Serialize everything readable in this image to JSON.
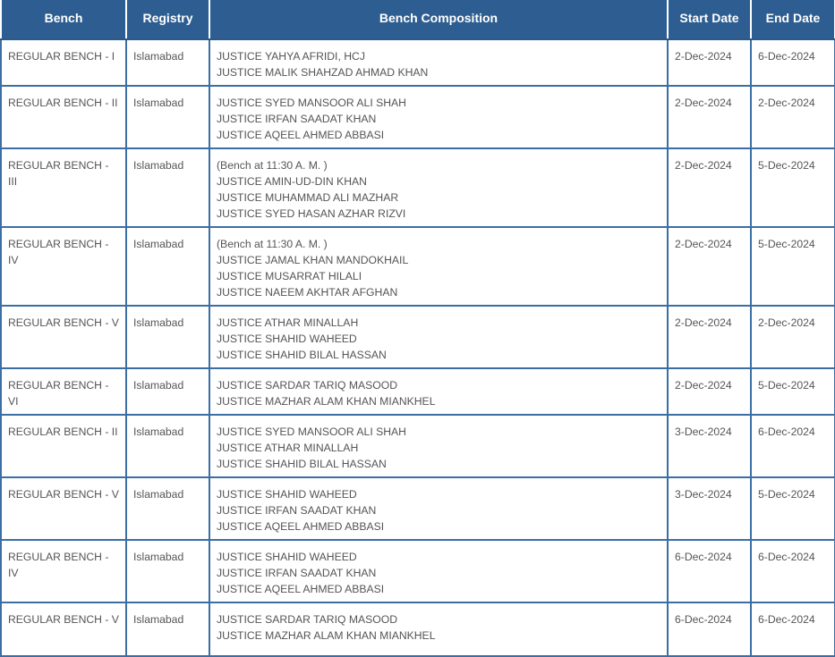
{
  "headers": {
    "bench": "Bench",
    "registry": "Registry",
    "composition": "Bench Composition",
    "start": "Start Date",
    "end": "End Date"
  },
  "rows": [
    {
      "bench": "REGULAR BENCH - I",
      "registry": "Islamabad",
      "composition": [
        "JUSTICE YAHYA AFRIDI, HCJ",
        "JUSTICE MALIK SHAHZAD AHMAD KHAN"
      ],
      "start": "2-Dec-2024",
      "end": "6-Dec-2024"
    },
    {
      "bench": "REGULAR BENCH - II",
      "registry": "Islamabad",
      "composition": [
        "JUSTICE SYED MANSOOR ALI SHAH",
        "JUSTICE IRFAN SAADAT KHAN",
        "JUSTICE AQEEL AHMED ABBASI"
      ],
      "start": "2-Dec-2024",
      "end": "2-Dec-2024"
    },
    {
      "bench": "REGULAR BENCH - III",
      "registry": "Islamabad",
      "composition": [
        "(Bench at 11:30 A. M. )",
        "JUSTICE AMIN-UD-DIN KHAN",
        "JUSTICE MUHAMMAD ALI MAZHAR",
        "JUSTICE SYED HASAN AZHAR RIZVI"
      ],
      "start": "2-Dec-2024",
      "end": "5-Dec-2024"
    },
    {
      "bench": "REGULAR BENCH - IV",
      "registry": "Islamabad",
      "composition": [
        "(Bench at 11:30 A. M. )",
        "JUSTICE JAMAL KHAN MANDOKHAIL",
        "JUSTICE MUSARRAT HILALI",
        "JUSTICE NAEEM AKHTAR AFGHAN"
      ],
      "start": "2-Dec-2024",
      "end": "5-Dec-2024"
    },
    {
      "bench": "REGULAR BENCH - V",
      "registry": "Islamabad",
      "composition": [
        "JUSTICE ATHAR MINALLAH",
        "JUSTICE SHAHID WAHEED",
        "JUSTICE SHAHID BILAL HASSAN"
      ],
      "start": "2-Dec-2024",
      "end": "2-Dec-2024"
    },
    {
      "bench": "REGULAR BENCH - VI",
      "registry": "Islamabad",
      "composition": [
        "JUSTICE SARDAR TARIQ MASOOD",
        "JUSTICE MAZHAR ALAM KHAN MIANKHEL"
      ],
      "start": "2-Dec-2024",
      "end": "5-Dec-2024"
    },
    {
      "bench": "REGULAR BENCH - II",
      "registry": "Islamabad",
      "composition": [
        "JUSTICE SYED MANSOOR ALI SHAH",
        "JUSTICE ATHAR MINALLAH",
        "JUSTICE SHAHID BILAL HASSAN"
      ],
      "start": "3-Dec-2024",
      "end": "6-Dec-2024"
    },
    {
      "bench": "REGULAR BENCH - V",
      "registry": "Islamabad",
      "composition": [
        "JUSTICE SHAHID WAHEED",
        "JUSTICE IRFAN SAADAT KHAN",
        "JUSTICE AQEEL AHMED ABBASI"
      ],
      "start": "3-Dec-2024",
      "end": "5-Dec-2024"
    },
    {
      "bench": "REGULAR BENCH - IV",
      "registry": "Islamabad",
      "composition": [
        "JUSTICE SHAHID WAHEED",
        "JUSTICE IRFAN SAADAT KHAN",
        "JUSTICE AQEEL AHMED ABBASI"
      ],
      "start": "6-Dec-2024",
      "end": "6-Dec-2024"
    },
    {
      "bench": "REGULAR BENCH - V",
      "registry": "Islamabad",
      "composition": [
        "JUSTICE SARDAR TARIQ MASOOD",
        "JUSTICE MAZHAR ALAM KHAN MIANKHEL"
      ],
      "start": "6-Dec-2024",
      "end": "6-Dec-2024"
    }
  ]
}
